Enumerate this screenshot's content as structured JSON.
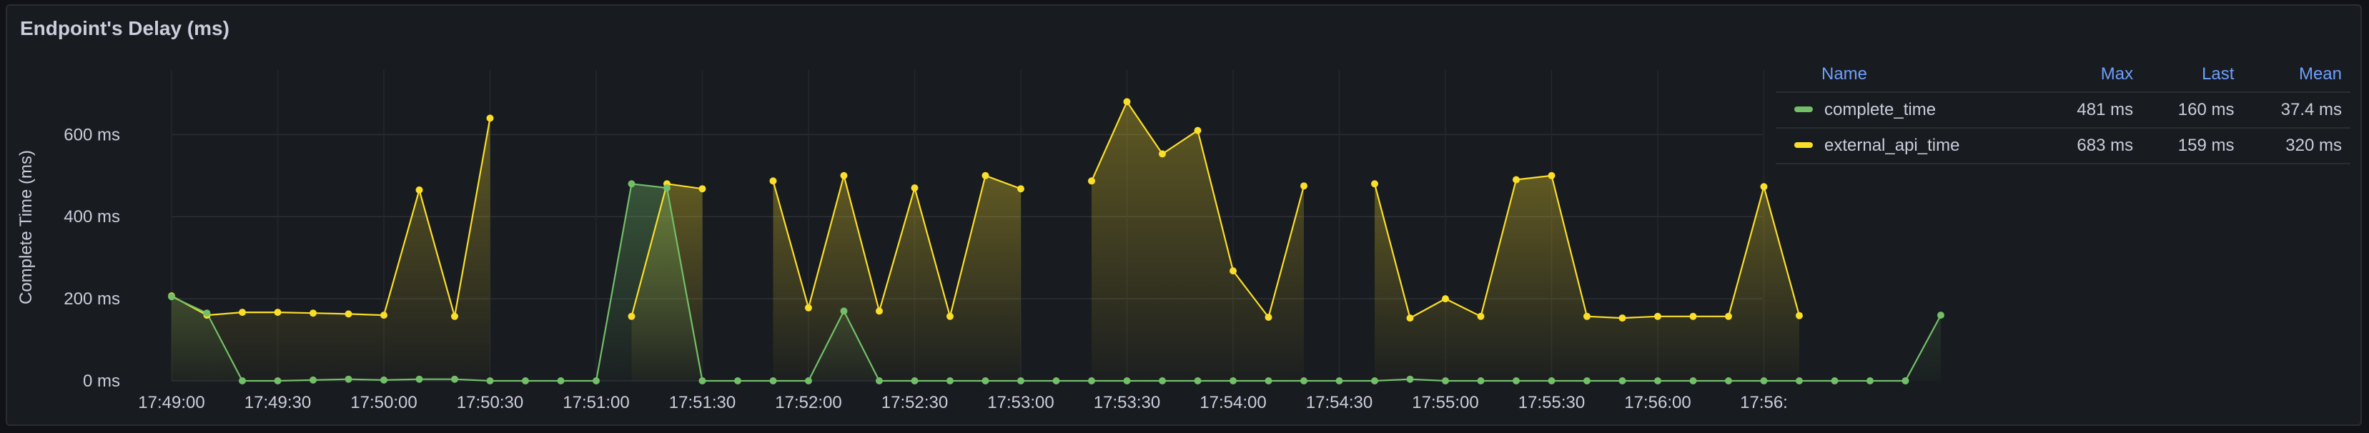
{
  "panel": {
    "title": "Endpoint's Delay (ms)"
  },
  "chart_data": {
    "type": "line",
    "title": "Endpoint's Delay (ms)",
    "ylabel": "Complete Time (ms)",
    "xlabel": "",
    "ylim": [
      0,
      800
    ],
    "yticks": [
      0,
      200,
      400,
      600
    ],
    "ytick_labels": [
      "0 ms",
      "200 ms",
      "400 ms",
      "600 ms"
    ],
    "x_start": "17:49:00",
    "x_step_seconds": 10,
    "xticks": [
      "17:49:00",
      "17:49:30",
      "17:50:00",
      "17:50:30",
      "17:51:00",
      "17:51:30",
      "17:52:00",
      "17:52:30",
      "17:53:00",
      "17:53:30",
      "17:54:00",
      "17:54:30",
      "17:55:00",
      "17:55:30",
      "17:56:00",
      "17:56:"
    ],
    "grid": true,
    "legend_position": "right",
    "series": [
      {
        "name": "complete_time",
        "color": "#73bf69",
        "values": [
          205,
          165,
          0,
          0,
          2,
          4,
          2,
          4,
          4,
          0,
          0,
          0,
          0,
          480,
          470,
          0,
          0,
          0,
          0,
          170,
          0,
          0,
          0,
          0,
          0,
          0,
          0,
          0,
          0,
          0,
          0,
          0,
          0,
          0,
          0,
          4,
          0,
          0,
          0,
          0,
          0,
          0,
          0,
          0,
          0,
          0,
          0,
          0,
          0,
          0,
          160
        ]
      },
      {
        "name": "external_api_time",
        "color": "#fade2a",
        "values": [
          207,
          160,
          167,
          167,
          165,
          163,
          160,
          465,
          157,
          640,
          null,
          null,
          null,
          157,
          480,
          468,
          null,
          487,
          178,
          500,
          170,
          470,
          157,
          500,
          468,
          null,
          487,
          680,
          553,
          610,
          268,
          155,
          475,
          null,
          480,
          153,
          200,
          157,
          490,
          500,
          157,
          153,
          157,
          157,
          157,
          473,
          159
        ]
      }
    ]
  },
  "legend": {
    "headers": {
      "name": "Name",
      "max": "Max",
      "last": "Last",
      "mean": "Mean"
    },
    "rows": [
      {
        "name": "complete_time",
        "color": "#73bf69",
        "max": "481 ms",
        "last": "160 ms",
        "mean": "37.4 ms"
      },
      {
        "name": "external_api_time",
        "color": "#fade2a",
        "max": "683 ms",
        "last": "159 ms",
        "mean": "320 ms"
      }
    ]
  }
}
